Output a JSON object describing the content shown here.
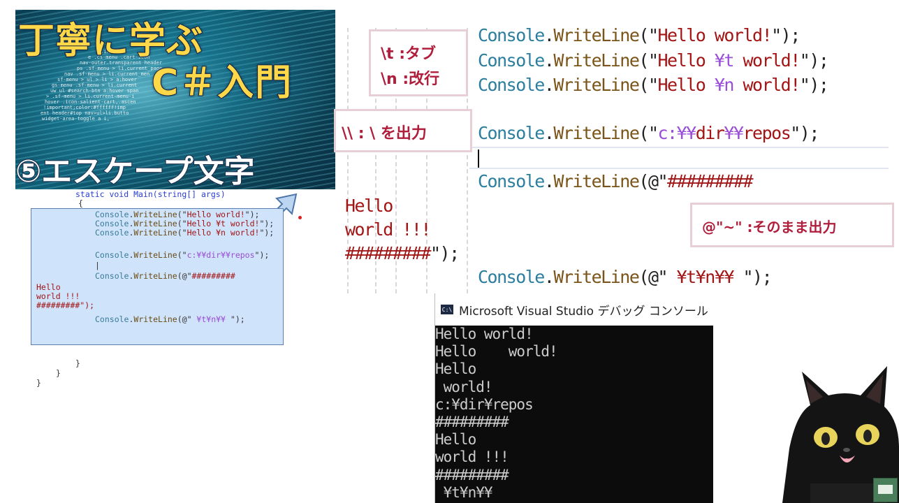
{
  "thumbnail": {
    "title_line1": "丁寧に学ぶ",
    "title_line2": "C＃入門",
    "subtitle": "⑤エスケープ文字",
    "bg_code": [
      "a.indicat",
      "e .cs-menu .cart-icon",
      "nav-outer.transparent header",
      "ps .sf-menu > li.current_page",
      "nav .sf-menu > li.current_men",
      "sf-menu > ul > li > a:hover",
      "gs-menu .sf-menu > li.current",
      "uw ul #search-btn a:hover span",
      "> .sf-menu > li.current-menu-i",
      "hover .icon-salient-cart,.ascen",
      "!important;color:#ffffff!imp",
      "ent header#top nav>ul>li.butto",
      "widget-area-toggle a i,"
    ]
  },
  "ide": {
    "header": "static void Main(string[] args)",
    "brace_open": "{",
    "lines": [
      {
        "cls": "Console",
        "mth": "WriteLine",
        "pre": "(\"",
        "str": "Hello world!",
        "post": "\");"
      },
      {
        "cls": "Console",
        "mth": "WriteLine",
        "pre": "(\"",
        "str": "Hello ¥t world!",
        "post": "\");"
      },
      {
        "cls": "Console",
        "mth": "WriteLine",
        "pre": "(\"",
        "str": "Hello ¥n world!",
        "post": "\");"
      },
      {
        "cls": "Console",
        "mth": "WriteLine",
        "pre": "(\"",
        "str": "c:¥¥dir¥¥repos",
        "post": "\");"
      },
      {
        "cls": "Console",
        "mth": "WriteLine",
        "pre": "(@\"",
        "str": "#########",
        "post": ""
      }
    ],
    "cursor": "|",
    "verbatim_rest": [
      "Hello",
      "world !!!",
      "#########\");"
    ],
    "last_line": {
      "cls": "Console",
      "mth": "WriteLine",
      "pre": "(@\" ",
      "str": "¥t¥n¥¥ ",
      "post": "\");"
    },
    "closing": [
      "}",
      "}",
      "}"
    ]
  },
  "code": {
    "line1": {
      "cls": "Console",
      "dot": ".",
      "mth": "WriteLine",
      "open": "(\"",
      "a": "Hello world!",
      "close": "\");"
    },
    "line2": {
      "cls": "Console",
      "dot": ".",
      "mth": "WriteLine",
      "open": "(\"",
      "a": "Hello ",
      "esc": "¥t",
      "b": " world!",
      "close": "\");"
    },
    "line3": {
      "cls": "Console",
      "dot": ".",
      "mth": "WriteLine",
      "open": "(\"",
      "a": "Hello ",
      "esc": "¥n",
      "b": " world!",
      "close": "\");"
    },
    "line4": {
      "cls": "Console",
      "dot": ".",
      "mth": "WriteLine",
      "open": "(\"",
      "a": "c:",
      "esc1": "¥¥",
      "b": "dir",
      "esc2": "¥¥",
      "c": "repos",
      "close": "\");"
    },
    "line5": {
      "cls": "Console",
      "dot": ".",
      "mth": "WriteLine",
      "open": "(@\"",
      "a": "#########"
    },
    "verbatim": [
      "Hello",
      "world !!!",
      "#########"
    ],
    "verbatim_close": "\");",
    "line6": {
      "cls": "Console",
      "dot": ".",
      "mth": "WriteLine",
      "open": "(@\" ",
      "a": "¥t¥n¥¥ ",
      "close": "\");"
    }
  },
  "annotations": {
    "tab": "\\t :タブ",
    "newline": "\\n :改行",
    "backslash": "\\\\ : \\ を出力",
    "verbatim": "@\"~\" :そのまま出力"
  },
  "console": {
    "icon": "C:\\",
    "title": "Microsoft Visual Studio デバッグ コンソール",
    "output": [
      "Hello world!",
      "Hello    world!",
      "Hello",
      " world!",
      "c:¥dir¥repos",
      "#########",
      "Hello",
      "world !!!",
      "#########",
      " ¥t¥n¥¥"
    ]
  },
  "colors": {
    "class": "#2b7e9e",
    "method": "#7a5418",
    "string": "#a31515",
    "escape": "#9a4dd8",
    "annotation_text": "#b01e3c",
    "annotation_border": "#e7cfd5"
  }
}
